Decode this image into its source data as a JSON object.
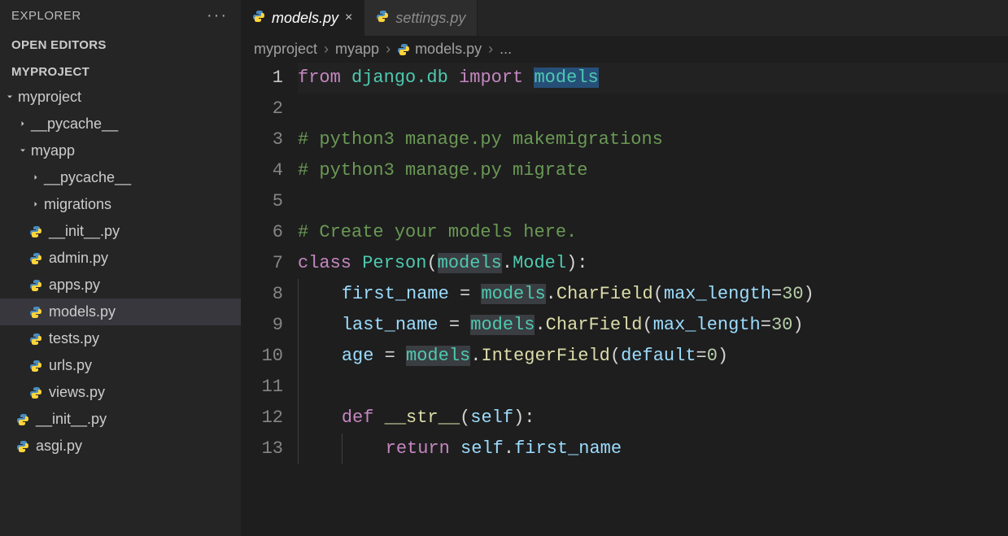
{
  "explorer": {
    "title": "EXPLORER",
    "sections": {
      "open_editors": "OPEN EDITORS",
      "project": "MYPROJECT"
    },
    "tree": {
      "myproject": "myproject",
      "pycache1": "__pycache__",
      "myapp": "myapp",
      "pycache2": "__pycache__",
      "migrations": "migrations",
      "init_py": "__init__.py",
      "admin_py": "admin.py",
      "apps_py": "apps.py",
      "models_py": "models.py",
      "tests_py": "tests.py",
      "urls_py": "urls.py",
      "views_py": "views.py",
      "root_init_py": "__init__.py",
      "asgi_py": "asgi.py"
    }
  },
  "tabs": {
    "active": "models.py",
    "inactive": "settings.py"
  },
  "breadcrumbs": {
    "a": "myproject",
    "b": "myapp",
    "c": "models.py",
    "d": "..."
  },
  "code": {
    "l1": {
      "from": "from",
      "django_db": "django.db",
      "import_kw": "import",
      "models_sel": "models"
    },
    "l3": "# python3 manage.py makemigrations",
    "l4": "# python3 manage.py migrate",
    "l6": "# Create your models here.",
    "l7": {
      "class_kw": "class",
      "Person": "Person",
      "models_hl": "models",
      "Model": "Model"
    },
    "l8": {
      "first_name": "first_name",
      "models_hl": "models",
      "CharField": "CharField",
      "max_length": "max_length",
      "v30": "30"
    },
    "l9": {
      "last_name": "last_name",
      "models_hl": "models",
      "CharField": "CharField",
      "max_length": "max_length",
      "v30": "30"
    },
    "l10": {
      "age": "age",
      "models_hl": "models",
      "IntegerField": "IntegerField",
      "default_kw": "default",
      "v0": "0"
    },
    "l12": {
      "def_kw": "def",
      "str_fn": "__str__",
      "self_kw": "self"
    },
    "l13": {
      "return_kw": "return",
      "self_kw": "self",
      "first_name": "first_name"
    }
  },
  "line_numbers": [
    "1",
    "2",
    "3",
    "4",
    "5",
    "6",
    "7",
    "8",
    "9",
    "10",
    "11",
    "12",
    "13"
  ]
}
